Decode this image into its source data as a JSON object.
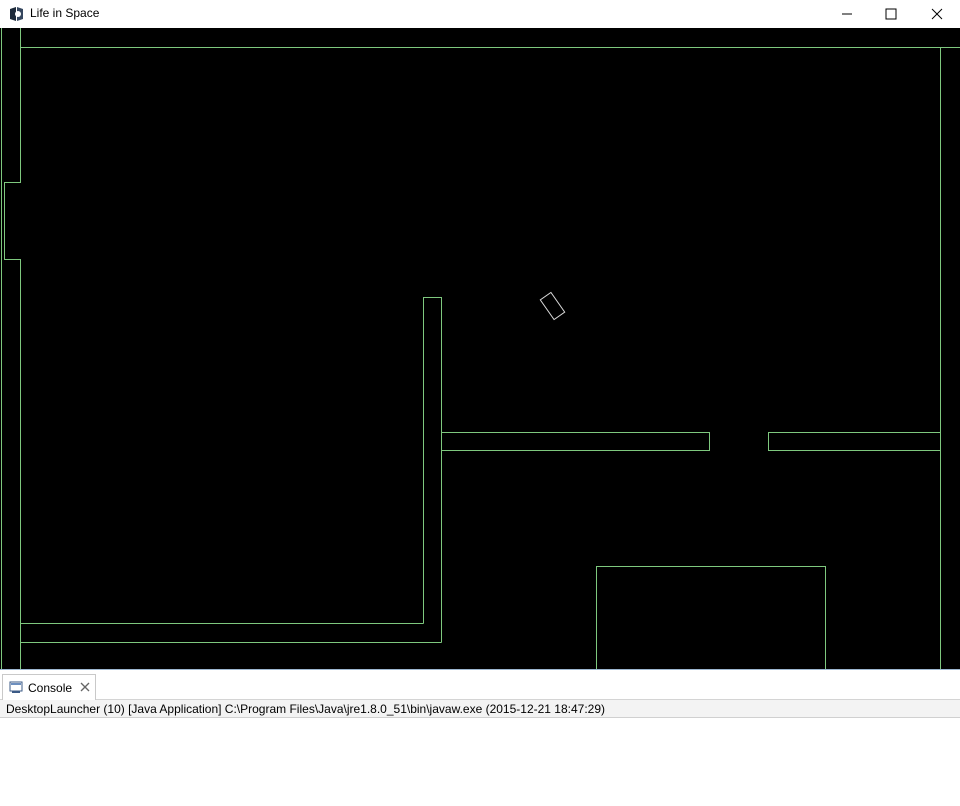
{
  "window": {
    "title": "Life in Space",
    "icon": "eclipse-java-app-icon",
    "controls": {
      "minimize_icon": "minimize-icon",
      "maximize_icon": "maximize-icon",
      "close_icon": "close-icon"
    }
  },
  "game": {
    "background_color": "#000000",
    "wall_color": "#7ec87e",
    "player_color": "#d8d8d8"
  },
  "console": {
    "tab_label": "Console",
    "tab_icon": "console-icon",
    "tab_close_icon": "close-icon",
    "status_text": "DesktopLauncher (10) [Java Application] C:\\Program Files\\Java\\jre1.8.0_51\\bin\\javaw.exe (2015-12-21 18:47:29)"
  }
}
